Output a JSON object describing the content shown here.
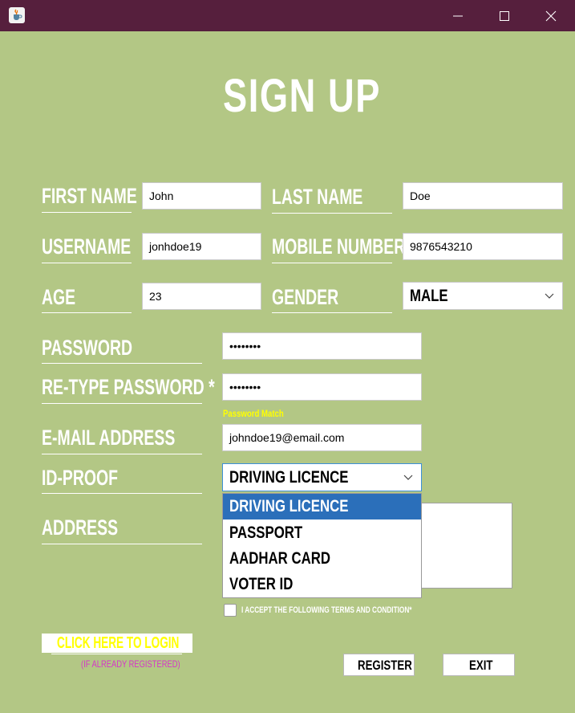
{
  "window": {
    "title_bar_color": "#561f3d",
    "background_color": "#b3c785",
    "app_icon": "java-cup-icon",
    "controls": [
      "minimize-icon",
      "maximize-icon",
      "close-icon"
    ]
  },
  "heading": "SIGN UP",
  "fields": {
    "first_name": {
      "label": "FIRST NAME",
      "value": "John"
    },
    "last_name": {
      "label": "LAST NAME",
      "value": "Doe"
    },
    "username": {
      "label": "USERNAME",
      "value": "jonhdoe19"
    },
    "mobile": {
      "label": "MOBILE NUMBER",
      "value": "9876543210"
    },
    "age": {
      "label": "AGE",
      "value": "23"
    },
    "gender": {
      "label": "GENDER",
      "value": "MALE"
    },
    "password": {
      "label": "PASSWORD",
      "value": "••••••••"
    },
    "retype_password": {
      "label": "RE-TYPE PASSWORD *",
      "value": "••••••••"
    },
    "email": {
      "label": "E-MAIL ADDRESS",
      "value": "johndoe19@email.com"
    },
    "id_proof": {
      "label": "ID-PROOF",
      "value": "DRIVING LICENCE"
    },
    "address": {
      "label": "ADDRESS",
      "value": ""
    }
  },
  "password_status": "Password Match",
  "password_status_color": "#ffff00",
  "id_proof_options": [
    "DRIVING LICENCE",
    "PASSPORT",
    "AADHAR CARD",
    "VOTER ID"
  ],
  "id_proof_selected": "DRIVING LICENCE",
  "terms": {
    "label": "I ACCEPT THE FOLLOWING TERMS AND CONDITION*",
    "checked": false
  },
  "login": {
    "label": "CLICK HERE TO LOGIN",
    "hint": "(IF ALREADY REGISTERED)",
    "color": "#ffff00",
    "hint_color": "#d633c9"
  },
  "buttons": {
    "register": "REGISTER",
    "exit": "EXIT"
  }
}
